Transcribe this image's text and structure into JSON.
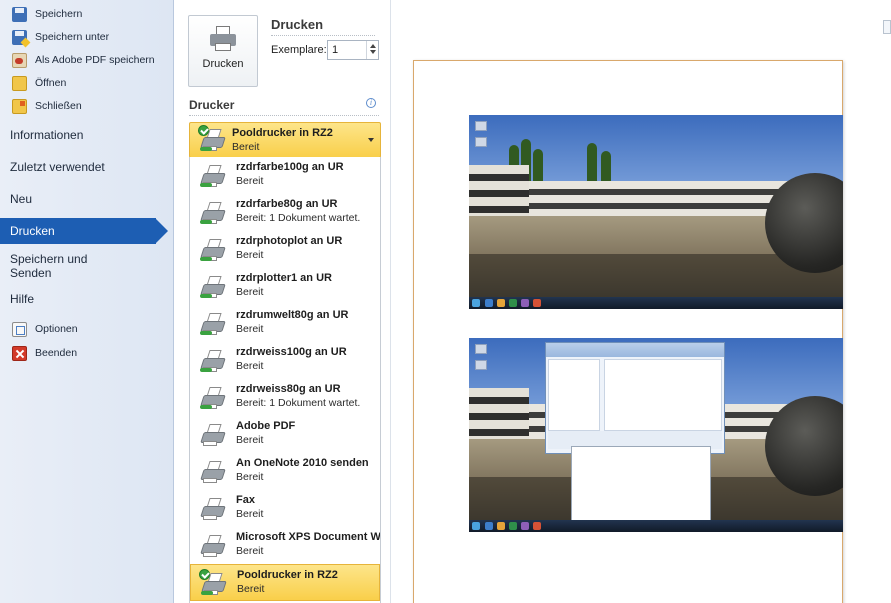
{
  "nav": {
    "small_items": [
      {
        "label": "Speichern",
        "icon": "save-icon"
      },
      {
        "label": "Speichern unter",
        "icon": "save-as-icon"
      },
      {
        "label": "Als Adobe PDF speichern",
        "icon": "adobe-pdf-icon"
      },
      {
        "label": "Öffnen",
        "icon": "folder-open-icon"
      },
      {
        "label": "Schließen",
        "icon": "folder-close-icon"
      }
    ],
    "informationen": "Informationen",
    "zuletzt": "Zuletzt verwendet",
    "neu": "Neu",
    "drucken": "Drucken",
    "speichern_senden": "Speichern und Senden",
    "hilfe": "Hilfe",
    "optionen": "Optionen",
    "beenden": "Beenden",
    "active_color": "#1d5eb3"
  },
  "print": {
    "button_label": "Drucken",
    "title": "Drucken",
    "copies_label": "Exemplare:",
    "copies_value": "1"
  },
  "printer_section": {
    "title": "Drucker",
    "selected_name": "Pooldrucker in RZ2",
    "selected_status": "Bereit",
    "highlight_color": "#f9cf4a",
    "list": [
      {
        "name": "rzdrfarbe100g an UR",
        "status": "Bereit"
      },
      {
        "name": "rzdrfarbe80g an UR",
        "status": "Bereit: 1 Dokument wartet."
      },
      {
        "name": "rzdrphotoplot an UR",
        "status": "Bereit"
      },
      {
        "name": "rzdrplotter1 an UR",
        "status": "Bereit"
      },
      {
        "name": "rzdrumwelt80g an UR",
        "status": "Bereit"
      },
      {
        "name": "rzdrweiss100g an UR",
        "status": "Bereit"
      },
      {
        "name": "rzdrweiss80g an UR",
        "status": "Bereit: 1 Dokument wartet."
      },
      {
        "name": "Adobe PDF",
        "status": "Bereit"
      },
      {
        "name": "An OneNote 2010 senden",
        "status": "Bereit"
      },
      {
        "name": "Fax",
        "status": "Bereit"
      },
      {
        "name": "Microsoft XPS Document Writer",
        "status": "Bereit"
      },
      {
        "name": "Pooldrucker in RZ2",
        "status": "Bereit",
        "selected": true
      }
    ]
  }
}
